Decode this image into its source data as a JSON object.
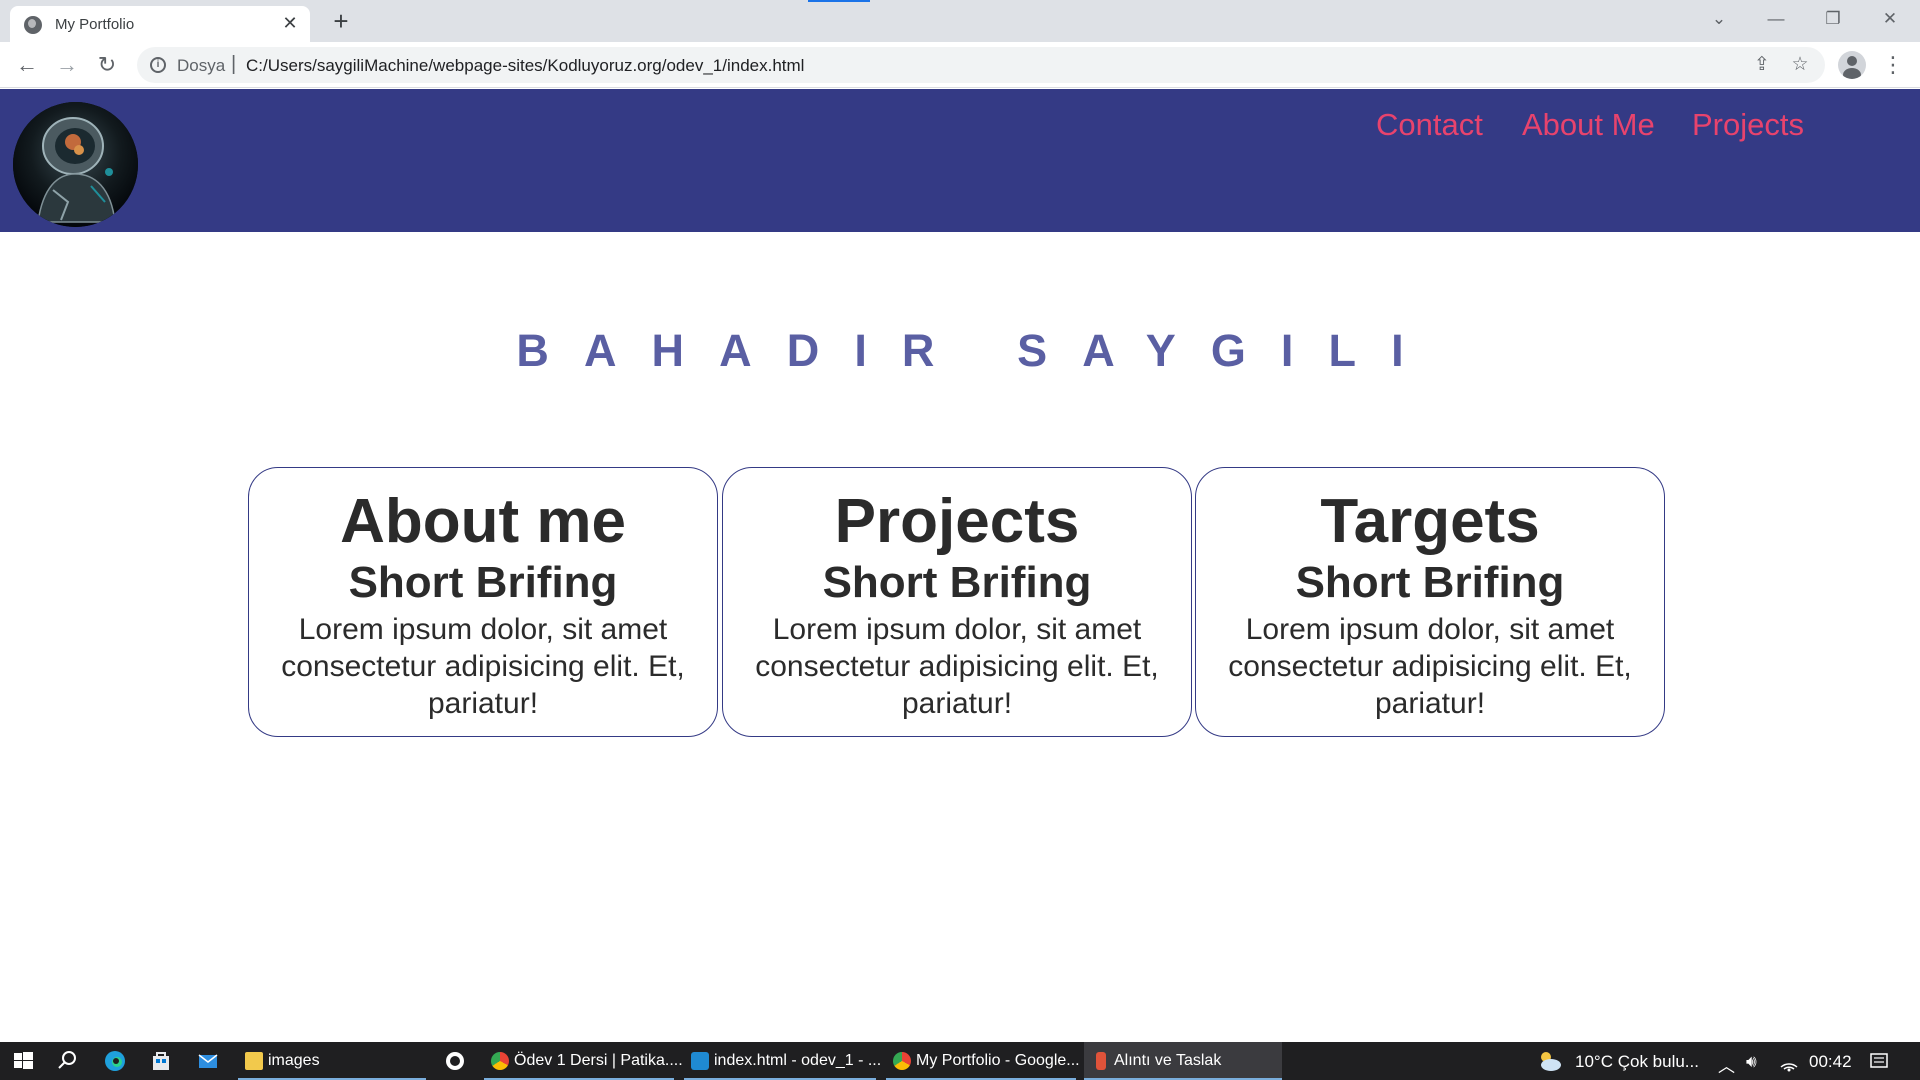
{
  "browser": {
    "tab_title": "My Portfolio",
    "tab_close": "✕",
    "new_tab": "+",
    "address": {
      "scheme_label": "Dosya",
      "separator": "|",
      "url": "C:/Users/saygiliMachine/webpage-sites/Kodluyoruz.org/odev_1/index.html"
    },
    "controls": {
      "tab_search": "⌄",
      "minimize": "—",
      "restore": "❐",
      "close": "✕",
      "back": "←",
      "forward": "→",
      "reload": "↻",
      "share": "⇪",
      "bookmark": "☆",
      "menu": "⋮"
    }
  },
  "site": {
    "nav": [
      {
        "label": "Contact"
      },
      {
        "label": "About Me"
      },
      {
        "label": "Projects"
      }
    ],
    "name": "BAHADIR SAYGILI",
    "cards": [
      {
        "title": "About me",
        "subtitle": "Short Brifing",
        "text": "Lorem ipsum dolor, sit amet consectetur adipisicing elit. Et, pariatur!"
      },
      {
        "title": "Projects",
        "subtitle": "Short Brifing",
        "text": "Lorem ipsum dolor, sit amet consectetur adipisicing elit. Et, pariatur!"
      },
      {
        "title": "Targets",
        "subtitle": "Short Brifing",
        "text": "Lorem ipsum dolor, sit amet consectetur adipisicing elit. Et, pariatur!"
      }
    ]
  },
  "taskbar": {
    "items": [
      {
        "label": "images"
      },
      {
        "label": "Ödev 1 Dersi | Patika...."
      },
      {
        "label": "index.html - odev_1 - ..."
      },
      {
        "label": "My Portfolio - Google..."
      },
      {
        "label": "Alıntı ve Taslak"
      }
    ],
    "weather": "10°C  Çok bulu...",
    "time": "00:42"
  },
  "colors": {
    "header_bg": "#343a85",
    "nav_link": "#e8436d",
    "name_text": "#5a5fa3",
    "card_border": "#343a85",
    "taskbar_bg": "#1f1f21"
  }
}
